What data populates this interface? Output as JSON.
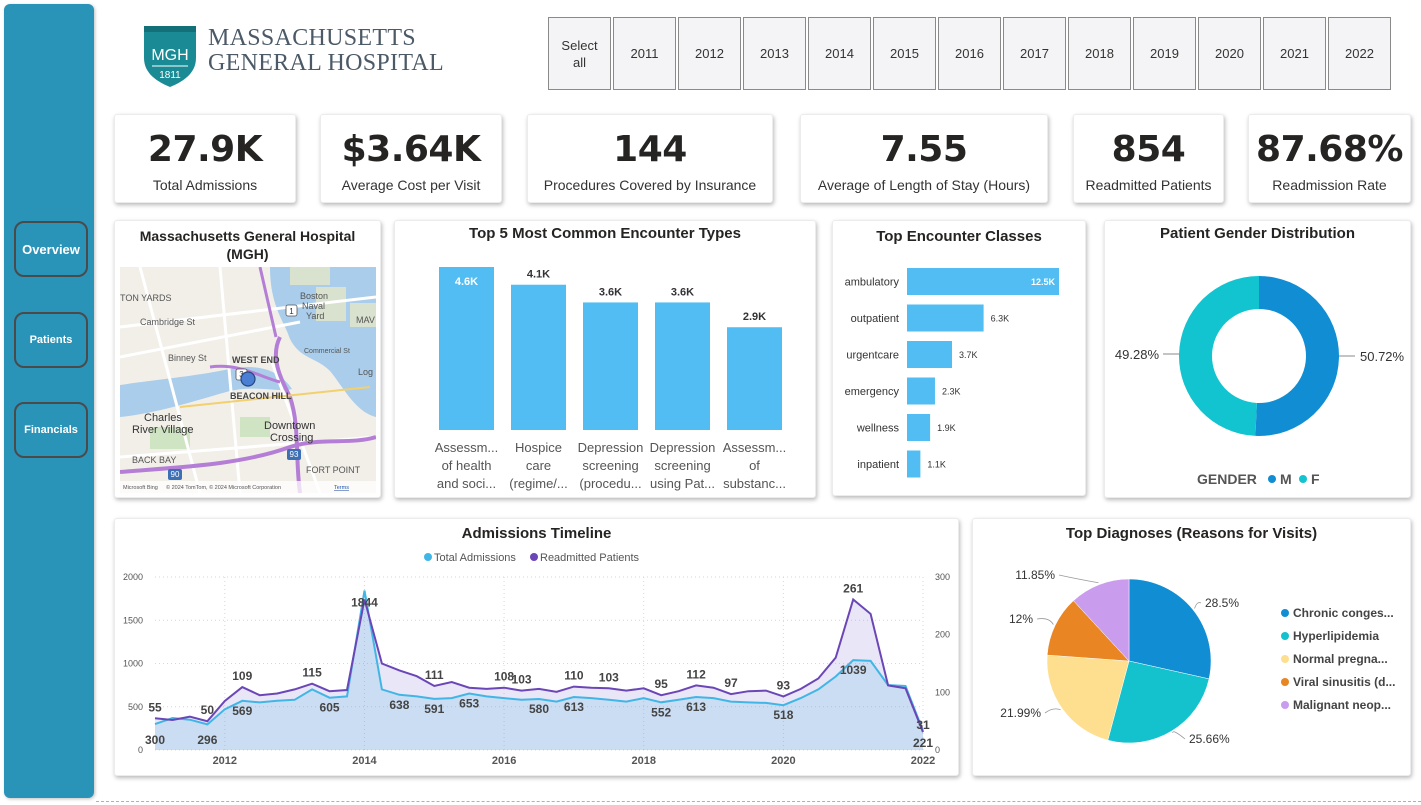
{
  "sidebar": {
    "items": [
      {
        "label": "Overview",
        "active": true
      },
      {
        "label": "Patients"
      },
      {
        "label": "Financials"
      }
    ]
  },
  "logo": {
    "badge_abbr": "MGH",
    "badge_year": "1811",
    "line1": "MASSACHUSETTS",
    "line2": "GENERAL HOSPITAL"
  },
  "year_filter": {
    "buttons": [
      "Select all",
      "2011",
      "2012",
      "2013",
      "2014",
      "2015",
      "2016",
      "2017",
      "2018",
      "2019",
      "2020",
      "2021",
      "2022"
    ]
  },
  "kpis": [
    {
      "value": "27.9K",
      "label": "Total Admissions"
    },
    {
      "value": "$3.64K",
      "label": "Average Cost per Visit"
    },
    {
      "value": "144",
      "label": "Procedures Covered by Insurance"
    },
    {
      "value": "7.55",
      "label": "Average of Length of Stay (Hours)"
    },
    {
      "value": "854",
      "label": "Readmitted Patients"
    },
    {
      "value": "87.68%",
      "label": "Readmission Rate"
    }
  ],
  "map": {
    "title": "Massachusetts General Hospital (MGH)",
    "labels": [
      "TON YARDS",
      "Boston",
      "Naval",
      "Yard",
      "Cambridge St",
      "Binney St",
      "WEST END",
      "BEACON HILL",
      "Charles",
      "River Village",
      "Downtown",
      "Crossing",
      "BACK BAY",
      "FORT POINT",
      "Commercial St",
      "MAV",
      "Log"
    ],
    "road_badges": [
      "1",
      "3",
      "90",
      "93"
    ],
    "attribution": "© 2024 TomTom, © 2024 Microsoft Corporation",
    "terms": "Terms",
    "brand": "Microsoft Bing"
  },
  "encounter_types": {
    "title": "Top 5 Most Common Encounter Types",
    "chart_data": {
      "type": "bar",
      "categories": [
        [
          "Assessm...",
          "of health",
          "and soci..."
        ],
        [
          "Hospice",
          "care",
          "(regime/..."
        ],
        [
          "Depression",
          "screening",
          "(procedu..."
        ],
        [
          "Depression",
          "screening",
          "using Pat..."
        ],
        [
          "Assessm...",
          "of",
          "substanc..."
        ]
      ],
      "values": [
        4.6,
        4.1,
        3.6,
        3.6,
        2.9
      ],
      "value_labels": [
        "4.6K",
        "4.1K",
        "3.6K",
        "3.6K",
        "2.9K"
      ],
      "color": "#52bdf2"
    }
  },
  "encounter_classes": {
    "title": "Top Encounter Classes",
    "chart_data": {
      "type": "bar",
      "orientation": "horizontal",
      "categories": [
        "ambulatory",
        "outpatient",
        "urgentcare",
        "emergency",
        "wellness",
        "inpatient"
      ],
      "values": [
        12.5,
        6.3,
        3.7,
        2.3,
        1.9,
        1.1
      ],
      "value_labels": [
        "12.5K",
        "6.3K",
        "3.7K",
        "2.3K",
        "1.9K",
        "1.1K"
      ],
      "color": "#52bdf2"
    }
  },
  "gender": {
    "title": "Patient Gender Distribution",
    "chart_data": {
      "type": "pie",
      "donut": true,
      "legend_title": "GENDER",
      "categories": [
        "M",
        "F"
      ],
      "values": [
        50.72,
        49.28
      ],
      "value_labels": [
        "50.72%",
        "49.28%"
      ],
      "colors": [
        "#118dd3",
        "#11c4cf"
      ]
    }
  },
  "timeline": {
    "title": "Admissions Timeline",
    "chart_data": {
      "type": "area",
      "x": [
        2011.0,
        2011.25,
        2011.5,
        2011.75,
        2012.0,
        2012.25,
        2012.5,
        2012.75,
        2013.0,
        2013.25,
        2013.5,
        2013.75,
        2014.0,
        2014.25,
        2014.5,
        2014.75,
        2015.0,
        2015.25,
        2015.5,
        2015.75,
        2016.0,
        2016.25,
        2016.5,
        2016.75,
        2017.0,
        2017.25,
        2017.5,
        2017.75,
        2018.0,
        2018.25,
        2018.5,
        2018.75,
        2019.0,
        2019.25,
        2019.5,
        2019.75,
        2020.0,
        2020.25,
        2020.5,
        2020.75,
        2021.0,
        2021.25,
        2021.5,
        2021.75,
        2022.0
      ],
      "series": [
        {
          "name": "Total Admissions",
          "axis": "left",
          "color": "#41b6e6",
          "values": [
            300,
            370,
            350,
            296,
            470,
            569,
            550,
            570,
            580,
            700,
            605,
            620,
            1844,
            700,
            638,
            620,
            591,
            600,
            653,
            620,
            600,
            580,
            590,
            560,
            613,
            600,
            580,
            560,
            600,
            552,
            580,
            613,
            600,
            560,
            550,
            545,
            518,
            600,
            700,
            850,
            1039,
            1030,
            750,
            740,
            221
          ]
        },
        {
          "name": "Readmitted Patients",
          "axis": "right",
          "color": "#6b46b7",
          "values": [
            55,
            52,
            58,
            50,
            85,
            109,
            95,
            98,
            105,
            115,
            102,
            104,
            261,
            150,
            138,
            128,
            111,
            118,
            108,
            106,
            108,
            103,
            106,
            101,
            110,
            108,
            107,
            103,
            107,
            95,
            102,
            112,
            108,
            97,
            102,
            103,
            93,
            106,
            124,
            160,
            261,
            236,
            112,
            107,
            31
          ]
        }
      ],
      "point_labels": [
        {
          "series": 1,
          "index": 0,
          "text": "55"
        },
        {
          "series": 0,
          "index": 0,
          "text": "300"
        },
        {
          "series": 1,
          "index": 5,
          "text": "109"
        },
        {
          "series": 1,
          "index": 3,
          "text": "50"
        },
        {
          "series": 0,
          "index": 3,
          "text": "296"
        },
        {
          "series": 0,
          "index": 5,
          "text": "569"
        },
        {
          "series": 1,
          "index": 9,
          "text": "115"
        },
        {
          "series": 0,
          "index": 10,
          "text": "605"
        },
        {
          "series": 0,
          "index": 12,
          "text": "1844"
        },
        {
          "series": 0,
          "index": 14,
          "text": "638"
        },
        {
          "series": 1,
          "index": 16,
          "text": "111"
        },
        {
          "series": 0,
          "index": 16,
          "text": "591"
        },
        {
          "series": 0,
          "index": 18,
          "text": "653"
        },
        {
          "series": 1,
          "index": 20,
          "text": "108"
        },
        {
          "series": 1,
          "index": 21,
          "text": "103"
        },
        {
          "series": 0,
          "index": 22,
          "text": "580"
        },
        {
          "series": 1,
          "index": 24,
          "text": "110"
        },
        {
          "series": 0,
          "index": 24,
          "text": "613"
        },
        {
          "series": 1,
          "index": 26,
          "text": "103"
        },
        {
          "series": 1,
          "index": 29,
          "text": "95"
        },
        {
          "series": 0,
          "index": 29,
          "text": "552"
        },
        {
          "series": 1,
          "index": 31,
          "text": "112"
        },
        {
          "series": 0,
          "index": 31,
          "text": "613"
        },
        {
          "series": 1,
          "index": 33,
          "text": "97"
        },
        {
          "series": 0,
          "index": 36,
          "text": "518"
        },
        {
          "series": 1,
          "index": 36,
          "text": "93"
        },
        {
          "series": 1,
          "index": 40,
          "text": "261"
        },
        {
          "series": 0,
          "index": 40,
          "text": "1039"
        },
        {
          "series": 1,
          "index": 44,
          "text": "31"
        },
        {
          "series": 0,
          "index": 44,
          "text": "221"
        }
      ],
      "ylim_left": [
        0,
        2000
      ],
      "yticks_left": [
        0,
        500,
        1000,
        1500,
        2000
      ],
      "ylim_right": [
        0,
        300
      ],
      "yticks_right": [
        0,
        100,
        200,
        300
      ],
      "xticks": [
        2012,
        2014,
        2016,
        2018,
        2020,
        2022
      ],
      "xlim": [
        2011,
        2022
      ],
      "legend_position": "top-center",
      "grid": true
    }
  },
  "diagnoses": {
    "title": "Top Diagnoses (Reasons for Visits)",
    "chart_data": {
      "type": "pie",
      "categories": [
        "Chronic conges...",
        "Hyperlipidemia",
        "Normal pregna...",
        "Viral sinusitis (d...",
        "Malignant neop..."
      ],
      "values": [
        28.5,
        25.66,
        21.99,
        12,
        11.85
      ],
      "value_labels": [
        "28.5%",
        "25.66%",
        "21.99%",
        "12%",
        "11.85%"
      ],
      "colors": [
        "#118dd3",
        "#14c2cd",
        "#fddf8f",
        "#e98523",
        "#c99cee"
      ]
    }
  }
}
